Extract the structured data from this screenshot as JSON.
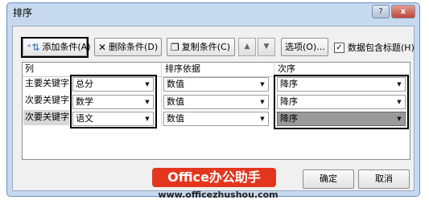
{
  "window": {
    "title": "排序",
    "help_label": "?",
    "close_label": "x"
  },
  "toolbar": {
    "add_level": "添加条件(A)",
    "delete_level": "删除条件(D)",
    "copy_level": "复制条件(C)",
    "move_up": "▲",
    "move_down": "▼",
    "options": "选项(O)...",
    "has_headers_label": "数据包含标题(H)",
    "has_headers_checked": "✓"
  },
  "grid": {
    "headers": {
      "column": "列",
      "sort_on": "排序依据",
      "order": "次序"
    },
    "rows": [
      {
        "label": "主要关键字",
        "column": "总分",
        "sort_on": "数值",
        "order": "降序"
      },
      {
        "label": "次要关键字",
        "column": "数学",
        "sort_on": "数值",
        "order": "降序"
      },
      {
        "label": "次要关键字",
        "column": "语文",
        "sort_on": "数值",
        "order": "降序"
      }
    ]
  },
  "footer": {
    "ok": "确定",
    "cancel": "取消"
  },
  "watermark": {
    "brand": "Office办公助手",
    "url": "www.officezhushou.com"
  },
  "colors": {
    "watermark_bg": "#e3361d",
    "titlebar": "#c7d9ef"
  }
}
